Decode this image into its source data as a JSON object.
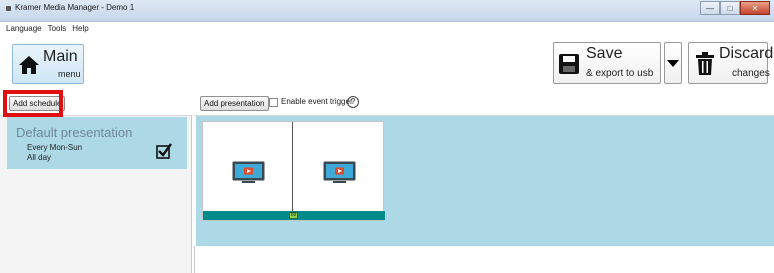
{
  "window": {
    "title": "Kramer Media Manager - Demo 1",
    "controls": {
      "minimize": "—",
      "maximize": "□",
      "close": "✕"
    }
  },
  "menu": {
    "items": [
      "Language",
      "Tools",
      "Help"
    ]
  },
  "toolbar": {
    "main": {
      "label": "Main",
      "sublabel": "menu",
      "icon": "home-icon"
    },
    "save": {
      "label": "Save",
      "sublabel": "& export to usb",
      "icon": "floppy-disk-icon"
    },
    "discard": {
      "label": "Discard",
      "sublabel": "changes",
      "icon": "trash-icon"
    }
  },
  "schedules": {
    "add_button": "Add schedule",
    "items": [
      {
        "name": "Default presentation",
        "days": "Every Mon-Sun",
        "time": "All day",
        "enabled": true
      }
    ]
  },
  "presentation": {
    "add_button": "Add presentation",
    "event_trigger_label": "Enable event trigger",
    "event_trigger_checked": false,
    "help": "?",
    "badge": "88"
  },
  "colors": {
    "selection": "#add8e6",
    "timeline_bar": "#008b8b",
    "highlight": "#e11010"
  }
}
